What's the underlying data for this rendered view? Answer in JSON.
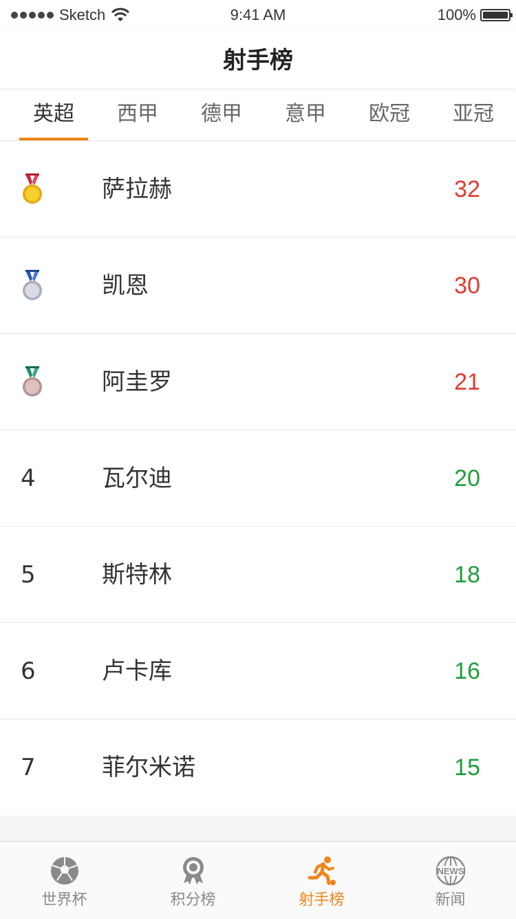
{
  "status_bar": {
    "carrier": "Sketch",
    "time": "9:41 AM",
    "battery": "100%"
  },
  "nav": {
    "title": "射手榜"
  },
  "tabs": [
    {
      "label": "英超",
      "active": true
    },
    {
      "label": "西甲",
      "active": false
    },
    {
      "label": "德甲",
      "active": false
    },
    {
      "label": "意甲",
      "active": false
    },
    {
      "label": "欧冠",
      "active": false
    },
    {
      "label": "亚冠",
      "active": false
    }
  ],
  "scorers": [
    {
      "rank": "",
      "medal": "gold-medal-icon",
      "name": "萨拉赫",
      "goals": "32",
      "goals_color": "#e03a2f"
    },
    {
      "rank": "",
      "medal": "silver-medal-icon",
      "name": "凯恩",
      "goals": "30",
      "goals_color": "#e03a2f"
    },
    {
      "rank": "",
      "medal": "bronze-medal-icon",
      "name": "阿圭罗",
      "goals": "21",
      "goals_color": "#e03a2f"
    },
    {
      "rank": "4",
      "medal": "",
      "name": "瓦尔迪",
      "goals": "20",
      "goals_color": "#1e9e3a"
    },
    {
      "rank": "5",
      "medal": "",
      "name": "斯特林",
      "goals": "18",
      "goals_color": "#1e9e3a"
    },
    {
      "rank": "6",
      "medal": "",
      "name": "卢卡库",
      "goals": "16",
      "goals_color": "#1e9e3a"
    },
    {
      "rank": "7",
      "medal": "",
      "name": "菲尔米诺",
      "goals": "15",
      "goals_color": "#1e9e3a"
    }
  ],
  "tab_bar": [
    {
      "label": "世界杯",
      "icon": "soccer-ball-icon",
      "active": false
    },
    {
      "label": "积分榜",
      "icon": "award-ribbon-icon",
      "active": false
    },
    {
      "label": "射手榜",
      "icon": "running-player-icon",
      "active": true
    },
    {
      "label": "新闻",
      "icon": "news-globe-icon",
      "active": false
    }
  ],
  "colors": {
    "accent": "#f0851a",
    "red": "#e03a2f",
    "green": "#1e9e3a"
  }
}
